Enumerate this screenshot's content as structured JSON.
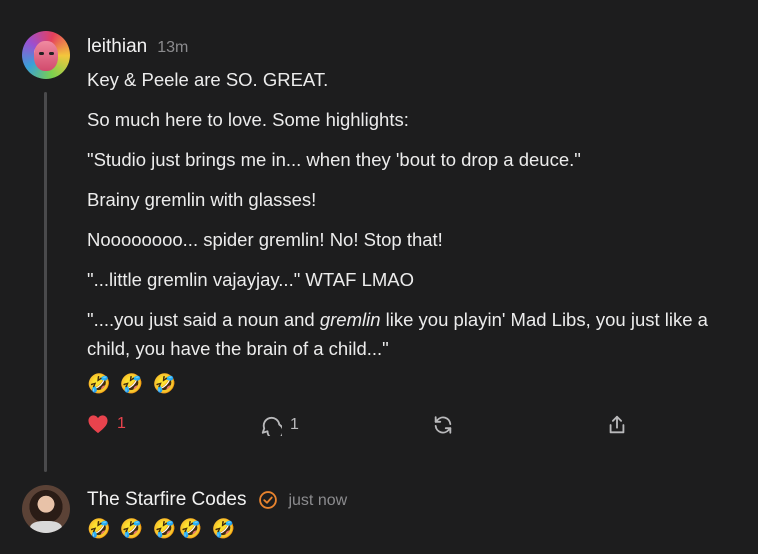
{
  "comment": {
    "username": "leithian",
    "timestamp": "13m",
    "paragraphs": [
      "Key & Peele are SO. GREAT.",
      "So much here to love. Some highlights:",
      "\"Studio just brings me in... when they 'bout to drop a deuce.\"",
      "Brainy gremlin with glasses!",
      "Noooooooo... spider gremlin! No! Stop that!",
      "\"...little gremlin vajayjay...\" WTAF LMAO"
    ],
    "last_paragraph": {
      "before": "\"....you just said a noun and ",
      "italic": "gremlin",
      "after": " like you playin' Mad Libs, you just like a child, you have the brain of a child...\""
    },
    "emojis": "🤣 🤣 🤣",
    "actions": {
      "likes": "1",
      "comments": "1"
    }
  },
  "reply": {
    "username": "The Starfire Codes",
    "timestamp": "just now",
    "emojis": "🤣 🤣 🤣🤣 🤣"
  },
  "colors": {
    "background": "#1d1d1e",
    "like": "#e8434d",
    "verified": "#e8832e"
  },
  "icons": [
    "heart-icon",
    "comment-icon",
    "restack-icon",
    "share-icon",
    "verified-icon"
  ]
}
